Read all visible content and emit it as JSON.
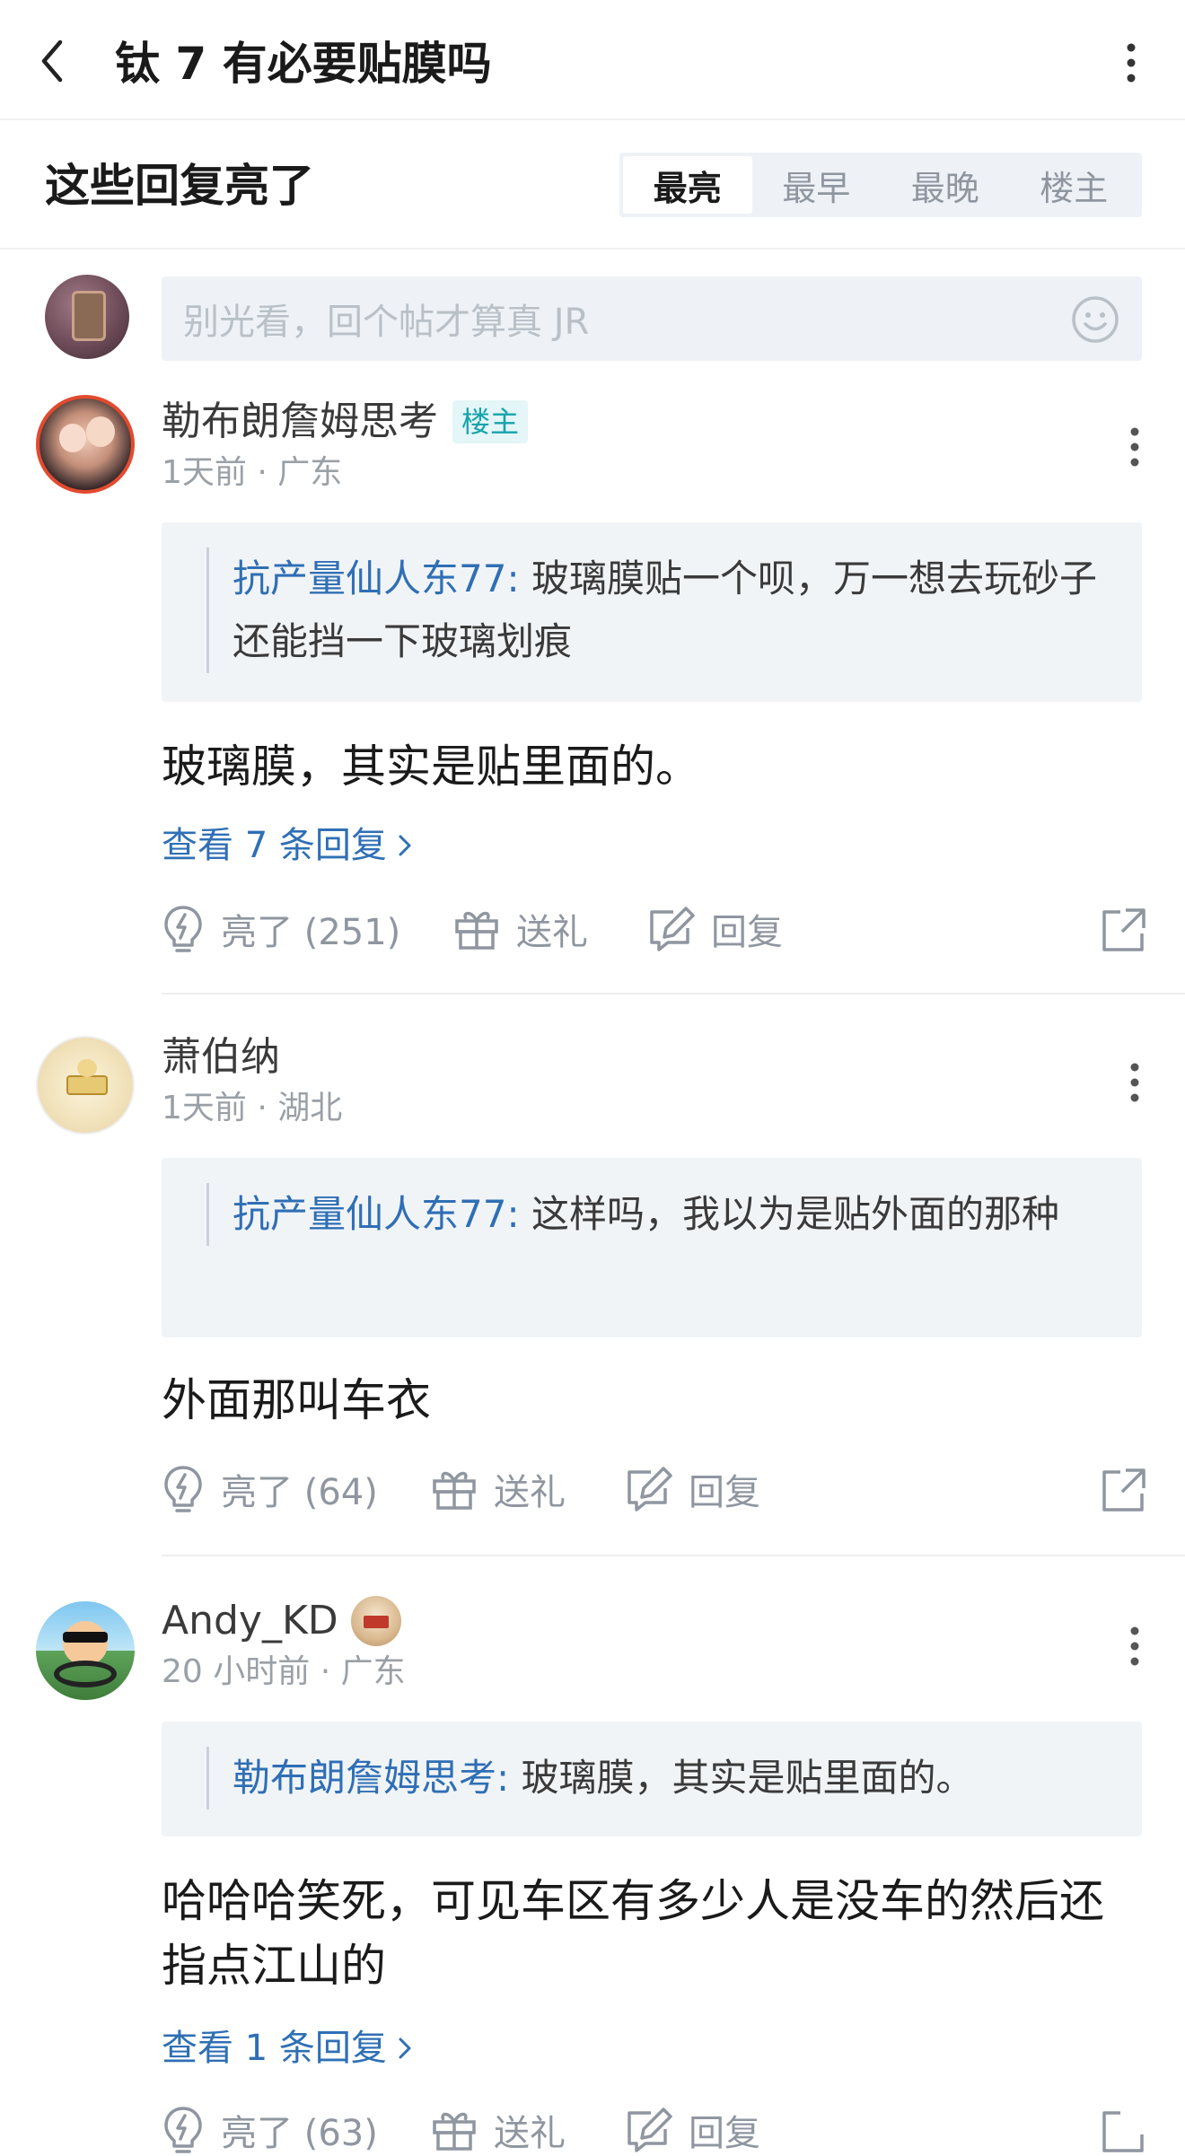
{
  "header": {
    "title": "钛 7 有必要贴膜吗"
  },
  "sort": {
    "section_title": "这些回复亮了",
    "tabs": [
      {
        "label": "最亮",
        "active": true
      },
      {
        "label": "最早",
        "active": false
      },
      {
        "label": "最晚",
        "active": false
      },
      {
        "label": "楼主",
        "active": false
      }
    ]
  },
  "compose": {
    "placeholder": "别光看，回个帖才算真 JR"
  },
  "comments": [
    {
      "username": "勒布朗詹姆思考",
      "badge": "楼主",
      "meta": "1天前 · 广东",
      "quote_author": "抗产量仙人东77:",
      "quote_text": " 玻璃膜贴一个呗，万一想去玩砂子还能挡一下玻璃划痕",
      "text": "玻璃膜，其实是贴里面的。",
      "view_replies": "查看 7 条回复",
      "like_label": "亮了 (251)",
      "gift_label": "送礼",
      "reply_label": "回复"
    },
    {
      "username": "萧伯纳",
      "meta": "1天前 · 湖北",
      "quote_author": "抗产量仙人东77:",
      "quote_text": " 这样吗，我以为是贴外面的那种",
      "text": "外面那叫车衣",
      "like_label": "亮了 (64)",
      "gift_label": "送礼",
      "reply_label": "回复"
    },
    {
      "username": "Andy_KD",
      "meta": "20 小时前 · 广东",
      "quote_author": "勒布朗詹姆思考:",
      "quote_text": " 玻璃膜，其实是贴里面的。",
      "text": "哈哈哈笑死，可见车区有多少人是没车的然后还指点江山的",
      "view_replies": "查看 1 条回复",
      "like_label": "亮了 (63)",
      "gift_label": "送礼",
      "reply_label": "回复"
    }
  ],
  "icons": {
    "back": "chevron-left-icon",
    "more": "more-vertical-icon",
    "emoji": "smiley-icon",
    "like": "lightbulb-icon",
    "gift": "gift-icon",
    "reply": "edit-icon",
    "share": "share-icon"
  },
  "colors": {
    "link_blue": "#2f6fb5",
    "op_badge_text": "#17a3ab",
    "op_badge_bg": "#e4f6f7",
    "muted": "#8f96a0",
    "quote_bg": "#f1f4f7"
  }
}
